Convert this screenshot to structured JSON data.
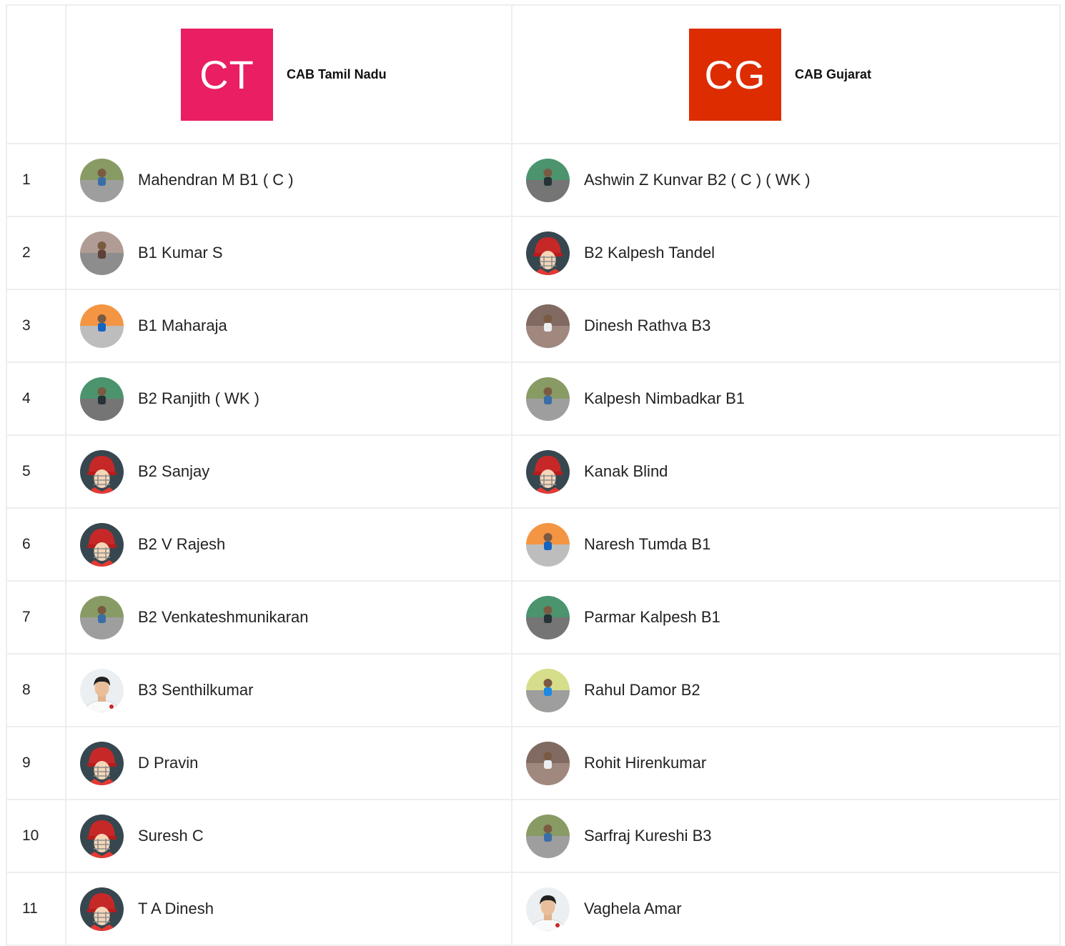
{
  "teams": [
    {
      "initials": "CT",
      "name": "CAB Tamil Nadu",
      "color": "#e91e63"
    },
    {
      "initials": "CG",
      "name": "CAB Gujarat",
      "color": "#dd2c00"
    }
  ],
  "rows": [
    {
      "num": "1",
      "p1": {
        "name": "Mahendran M B1 ( C )",
        "avatar": "photo"
      },
      "p2": {
        "name": "Ashwin Z Kunvar B2 ( C ) ( WK )",
        "avatar": "photo"
      }
    },
    {
      "num": "2",
      "p1": {
        "name": "B1 Kumar S",
        "avatar": "photo"
      },
      "p2": {
        "name": "B2 Kalpesh Tandel",
        "avatar": "helmet"
      }
    },
    {
      "num": "3",
      "p1": {
        "name": "B1 Maharaja",
        "avatar": "photo"
      },
      "p2": {
        "name": "Dinesh Rathva B3",
        "avatar": "photo"
      }
    },
    {
      "num": "4",
      "p1": {
        "name": "B2 Ranjith ( WK )",
        "avatar": "photo"
      },
      "p2": {
        "name": "Kalpesh Nimbadkar B1",
        "avatar": "photo"
      }
    },
    {
      "num": "5",
      "p1": {
        "name": "B2 Sanjay",
        "avatar": "helmet"
      },
      "p2": {
        "name": "Kanak Blind",
        "avatar": "helmet"
      }
    },
    {
      "num": "6",
      "p1": {
        "name": "B2 V Rajesh",
        "avatar": "helmet"
      },
      "p2": {
        "name": "Naresh Tumda B1",
        "avatar": "photo"
      }
    },
    {
      "num": "7",
      "p1": {
        "name": "B2 Venkateshmunikaran",
        "avatar": "photo"
      },
      "p2": {
        "name": "Parmar Kalpesh B1",
        "avatar": "photo"
      }
    },
    {
      "num": "8",
      "p1": {
        "name": "B3 Senthilkumar",
        "avatar": "batter"
      },
      "p2": {
        "name": "Rahul Damor B2",
        "avatar": "photo"
      }
    },
    {
      "num": "9",
      "p1": {
        "name": "D Pravin",
        "avatar": "helmet"
      },
      "p2": {
        "name": "Rohit Hirenkumar",
        "avatar": "photo"
      }
    },
    {
      "num": "10",
      "p1": {
        "name": "Suresh C",
        "avatar": "helmet"
      },
      "p2": {
        "name": "Sarfraj Kureshi B3",
        "avatar": "photo"
      }
    },
    {
      "num": "11",
      "p1": {
        "name": "T A Dinesh",
        "avatar": "helmet"
      },
      "p2": {
        "name": "Vaghela Amar",
        "avatar": "batter"
      }
    }
  ]
}
